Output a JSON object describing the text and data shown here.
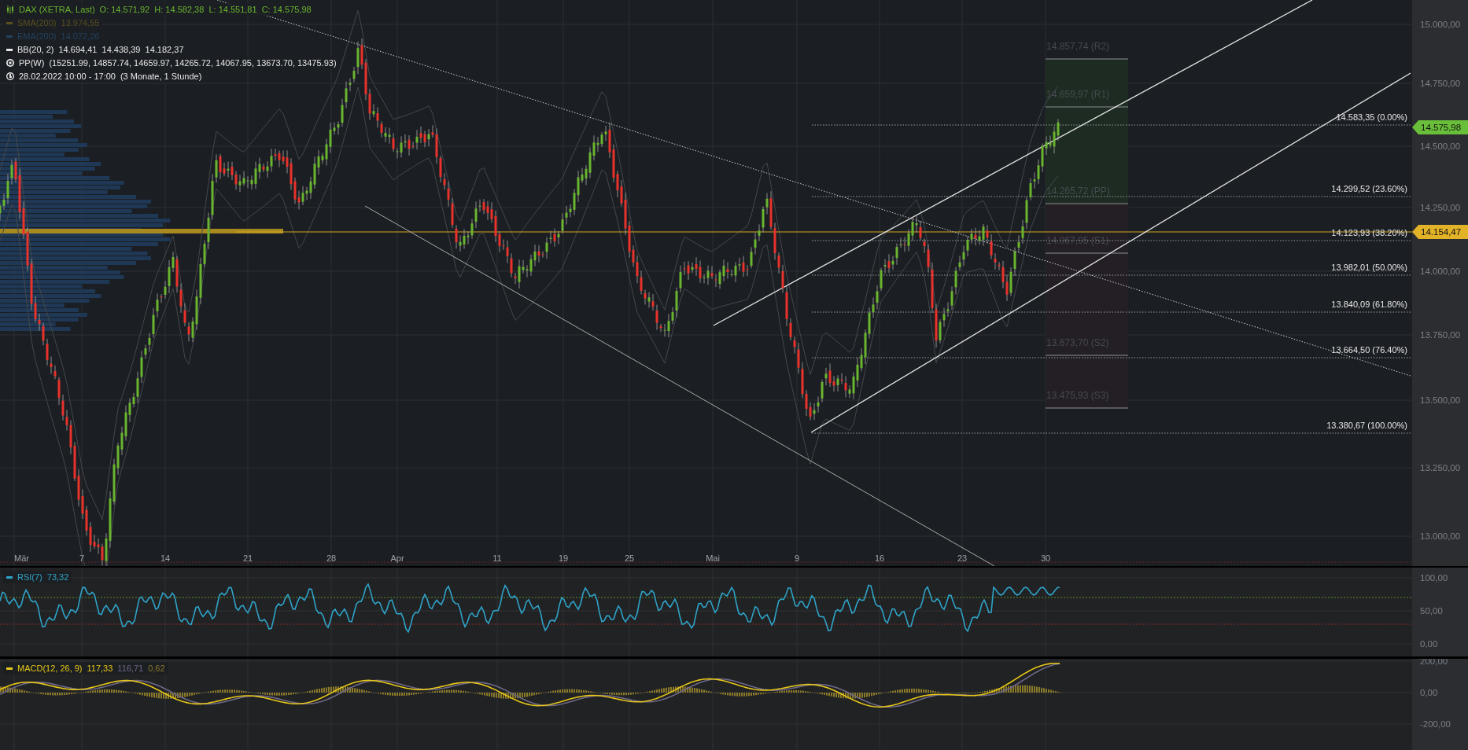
{
  "legend": [
    {
      "kind": "candles",
      "label": "DAX (XETRA, Last)",
      "values": "O: 14.571,92  H: 14.582,38  L: 14.551,81  C: 14.575,98",
      "color": "#6ab52f"
    },
    {
      "kind": "line",
      "label": "SMA(200)",
      "values": "13.974,55",
      "color": "#5a5020"
    },
    {
      "kind": "line",
      "label": "EMA(200)",
      "values": "14.072,26",
      "color": "#24425f"
    },
    {
      "kind": "line",
      "label": "BB(20, 2)",
      "values": "14.694,41  14.438,39  14.182,37",
      "color": "#e6e6e6"
    },
    {
      "kind": "pivot",
      "label": "PP(W)",
      "values": "(15251.99, 14857.74, 14659.97, 14265.72, 14067.95, 13673.70, 13475.93)",
      "color": "#e6e6e6"
    },
    {
      "kind": "clock",
      "label": "28.02.2022 10:00 - 17:00",
      "values": "(3 Monate, 1 Stunde)",
      "color": "#e6e6e6"
    }
  ],
  "price_axis": [
    "15.000,00",
    "14.750,00",
    "14.500,00",
    "14.250,00",
    "14.000,00",
    "13.750,00",
    "13.500,00",
    "13.250,00",
    "13.000,00"
  ],
  "price_tags": [
    {
      "text": "14.575,98",
      "color": "#6abf3a"
    },
    {
      "text": "14.154,47",
      "color": "#e2b227"
    }
  ],
  "fib_levels": [
    "14.583,35 (0.00%)",
    "14.299,52 (23.60%)",
    "14.123,93 (38.20%)",
    "13.982,01 (50.00%)",
    "13.840,09 (61.80%)",
    "13.664,50 (76.40%)",
    "13.380,67 (100.00%)"
  ],
  "pivot_levels": [
    "14.857,74 (R2)",
    "14.659,97 (R1)",
    "14.265,72 (PP)",
    "14.067,95 (S1)",
    "13.673,70 (S2)",
    "13.475,93 (S3)"
  ],
  "time_axis": [
    "Mär",
    "7",
    "14",
    "21",
    "28",
    "Apr",
    "11",
    "19",
    "25",
    "Mai",
    "9",
    "16",
    "23",
    "30"
  ],
  "rsi": {
    "label": "RSI(7)",
    "value": "73,32",
    "axis": [
      "100,00",
      "50,00",
      "0,00"
    ]
  },
  "macd": {
    "label": "MACD(12, 26, 9)",
    "values": [
      "117,33",
      "116,71",
      "0,62"
    ],
    "axis": [
      "200,00",
      "0,00",
      "-200,00"
    ]
  }
}
